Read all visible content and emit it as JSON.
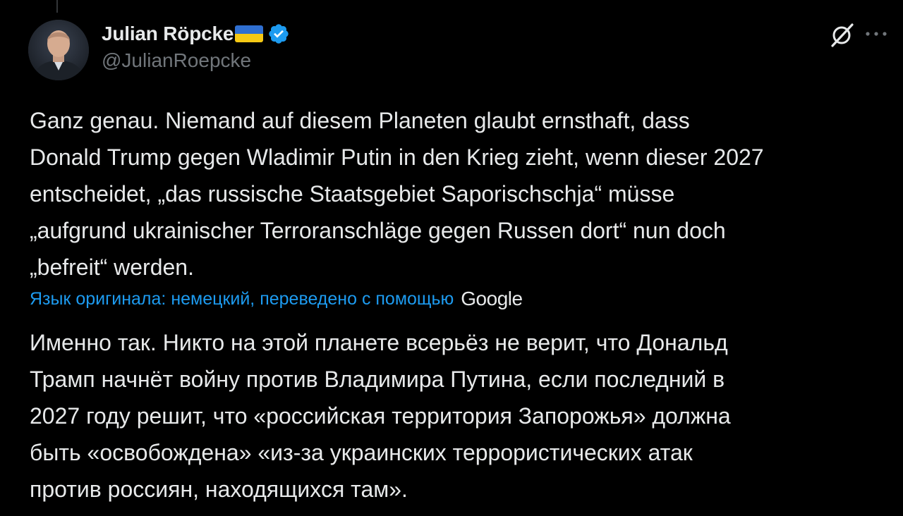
{
  "author": {
    "display_name": "Julian Röpcke",
    "handle": "@JulianRoepcke",
    "flag": "ukraine-flag-icon",
    "verified_icon": "verified-badge-icon",
    "verified_color": "#1d9bf0"
  },
  "header_actions": {
    "grok_icon": "grok-icon",
    "more_icon": "more-options-icon"
  },
  "tweet": {
    "lines": [
      "Ganz genau. Niemand auf diesem Planeten glaubt ernsthaft, dass",
      "Donald Trump gegen Wladimir Putin in den Krieg zieht, wenn dieser 2027",
      "entscheidet, „das russische Staatsgebiet Saporischschja“ müsse",
      "„aufgrund ukrainischer Terroranschläge gegen Russen dort“ nun doch",
      "„befreit“ werden."
    ]
  },
  "translation": {
    "note": "Язык оригинала: немецкий, переведено с помощью",
    "provider": "Google",
    "lines": [
      "Именно так. Никто на этой планете всерьёз не верит, что Дональд",
      "Трамп начнёт войну против Владимира Путина, если последний в",
      "2027 году решит, что «российская территория Запорожья» должна",
      "быть «освобождена» «из-за украинских террористических атак",
      "против россиян, находящихся там»."
    ]
  },
  "colors": {
    "background": "#000000",
    "text": "#e7e9ea",
    "secondary_text": "#71767b",
    "accent": "#1d9bf0"
  }
}
